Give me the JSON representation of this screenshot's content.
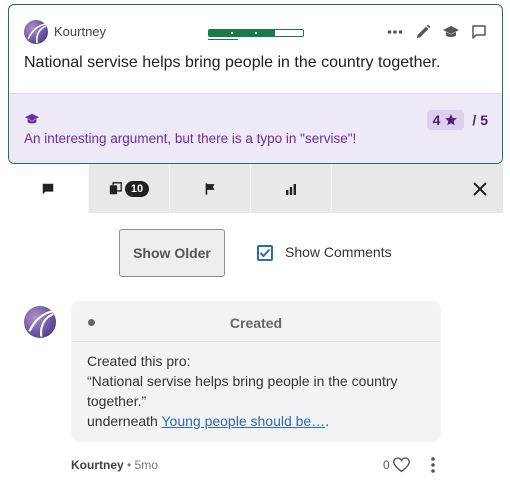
{
  "claim": {
    "author": "Kourtney",
    "progress": 0.7,
    "text": "National servise helps bring people in the country together.",
    "icons": [
      "more-horizontal-icon",
      "pencil-icon",
      "graduation-cap-icon",
      "comment-icon"
    ]
  },
  "review": {
    "icon": "graduation-cap-icon",
    "text": "An interesting argument, but there is a typo in \"servise\"!",
    "rating": "4",
    "rating_out_of": "/ 5",
    "star_icon": "star-icon"
  },
  "tabs": [
    {
      "icon": "comment-icon",
      "active": true
    },
    {
      "icon": "copy-icon",
      "badge": "10"
    },
    {
      "icon": "flag-icon"
    },
    {
      "icon": "bar-chart-icon"
    }
  ],
  "controls": {
    "show_older_label": "Show Older",
    "show_comments_label": "Show Comments",
    "show_comments_checked": true
  },
  "activity": {
    "title": "Created",
    "line1": "Created this pro:",
    "quote": "“National servise helps bring people in the country together.”",
    "underneath": "underneath ",
    "link_text": "Young people should be…",
    "after_link": ".",
    "author": "Kourtney",
    "time": "• 5mo",
    "likes": "0"
  },
  "colors": {
    "accent_green": "#1b7a4b",
    "review_purple": "#6b2fa0",
    "review_bg": "#efe8f6",
    "link_blue": "#2f6ab4"
  }
}
